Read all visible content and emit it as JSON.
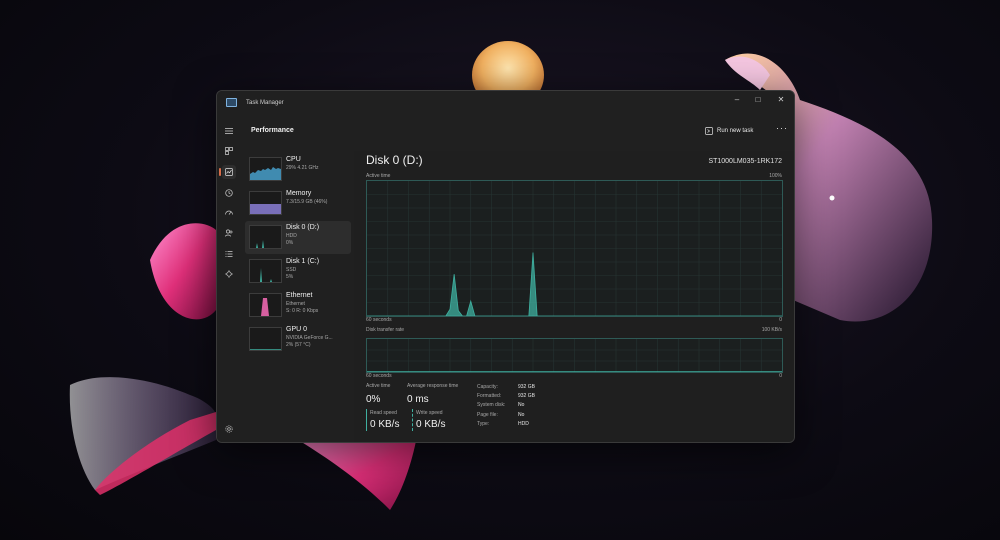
{
  "window": {
    "title": "Task Manager"
  },
  "nav": [
    {
      "icon": "hamburger-icon"
    },
    {
      "icon": "processes-icon"
    },
    {
      "icon": "performance-icon",
      "active": true
    },
    {
      "icon": "app-history-icon"
    },
    {
      "icon": "startup-apps-icon"
    },
    {
      "icon": "users-icon"
    },
    {
      "icon": "details-icon"
    },
    {
      "icon": "services-icon"
    },
    {
      "icon": "settings-icon"
    }
  ],
  "header": {
    "title": "Performance",
    "run_new_task": "Run new task",
    "more": "···"
  },
  "sidebar": {
    "items": [
      {
        "name": "CPU",
        "line1": "29% 4.21 GHz",
        "line2": "",
        "color": "#4aa8d6"
      },
      {
        "name": "Memory",
        "line1": "7.3/15.9 GB (46%)",
        "line2": "",
        "color": "#8b7fd6"
      },
      {
        "name": "Disk 0 (D:)",
        "line1": "HDD",
        "line2": "0%",
        "color": "#3fb0a0",
        "selected": true
      },
      {
        "name": "Disk 1 (C:)",
        "line1": "SSD",
        "line2": "5%",
        "color": "#3fb0a0"
      },
      {
        "name": "Ethernet",
        "line1": "Ethernet",
        "line2": "S: 0 R: 0 Kbps",
        "color": "#d75fa0"
      },
      {
        "name": "GPU 0",
        "line1": "NVIDIA GeForce G...",
        "line2": "2% (57 °C)",
        "color": "#3fb0a0"
      }
    ]
  },
  "disk": {
    "title": "Disk 0 (D:)",
    "model": "ST1000LM035-1RK172",
    "active_time_label": "Active time",
    "active_time_max": "100%",
    "active_time_span": "60 seconds",
    "active_time_min": "0",
    "active_time_series": [
      0,
      0,
      0,
      0,
      0,
      0,
      0,
      0,
      0,
      0,
      0,
      0,
      0,
      0,
      0,
      0,
      0,
      0,
      0,
      0,
      5,
      31,
      4,
      0,
      0,
      11,
      0,
      0,
      0,
      0,
      0,
      0,
      0,
      0,
      0,
      0,
      0,
      0,
      0,
      0,
      47,
      0,
      0,
      0,
      0,
      0,
      0,
      0,
      0,
      0,
      0,
      0,
      0,
      0,
      0,
      0,
      0,
      0,
      0,
      0,
      0,
      0,
      0,
      0,
      0,
      0,
      0,
      0,
      0,
      0,
      0,
      0,
      0,
      0,
      0,
      0,
      0,
      0,
      0,
      0,
      0,
      0,
      0,
      0,
      0,
      0,
      0,
      0,
      0,
      0,
      0,
      0,
      0,
      0,
      0,
      0,
      0,
      0,
      0,
      0,
      0
    ],
    "transfer_label": "Disk transfer rate",
    "transfer_max": "100 KB/s",
    "transfer_span": "60 seconds",
    "transfer_min": "0",
    "stats": {
      "active_time_label": "Active time",
      "active_time_value": "0%",
      "avg_response_label": "Average response time",
      "avg_response_value": "0 ms",
      "read_label": "Read speed",
      "read_value": "0 KB/s",
      "write_label": "Write speed",
      "write_value": "0 KB/s"
    },
    "props": [
      {
        "k": "Capacity:",
        "v": "932 GB"
      },
      {
        "k": "Formatted:",
        "v": "932 GB"
      },
      {
        "k": "System disk:",
        "v": "No"
      },
      {
        "k": "Page file:",
        "v": "No"
      },
      {
        "k": "Type:",
        "v": "HDD"
      }
    ],
    "accent": "#3fb0a0"
  }
}
